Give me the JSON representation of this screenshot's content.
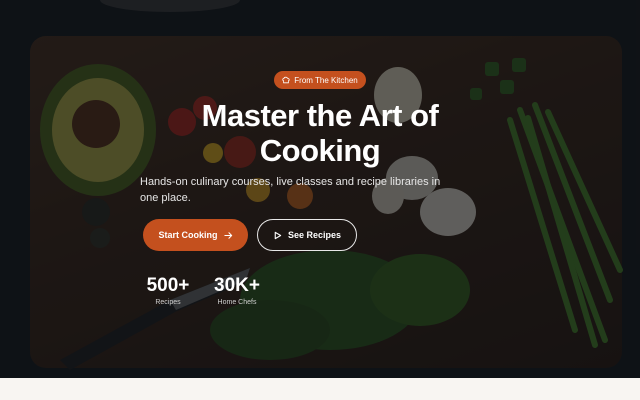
{
  "hero": {
    "badge": {
      "label": "From The Kitchen",
      "icon": "chef-hat-icon"
    },
    "title": "Master the Art of Cooking",
    "subtitle": "Hands-on culinary courses, live classes and recipe libraries in one place.",
    "primary_button": {
      "label": "Start Cooking",
      "icon": "arrow-right-icon"
    },
    "secondary_button": {
      "label": "See Recipes",
      "icon": "play-icon"
    },
    "stats": [
      {
        "value": "500+",
        "label": "Recipes"
      },
      {
        "value": "30K+",
        "label": "Home Chefs"
      }
    ]
  },
  "colors": {
    "accent": "#c4501e",
    "overlay": "#0c0e12",
    "bottom_section": "#f8f5f2"
  }
}
